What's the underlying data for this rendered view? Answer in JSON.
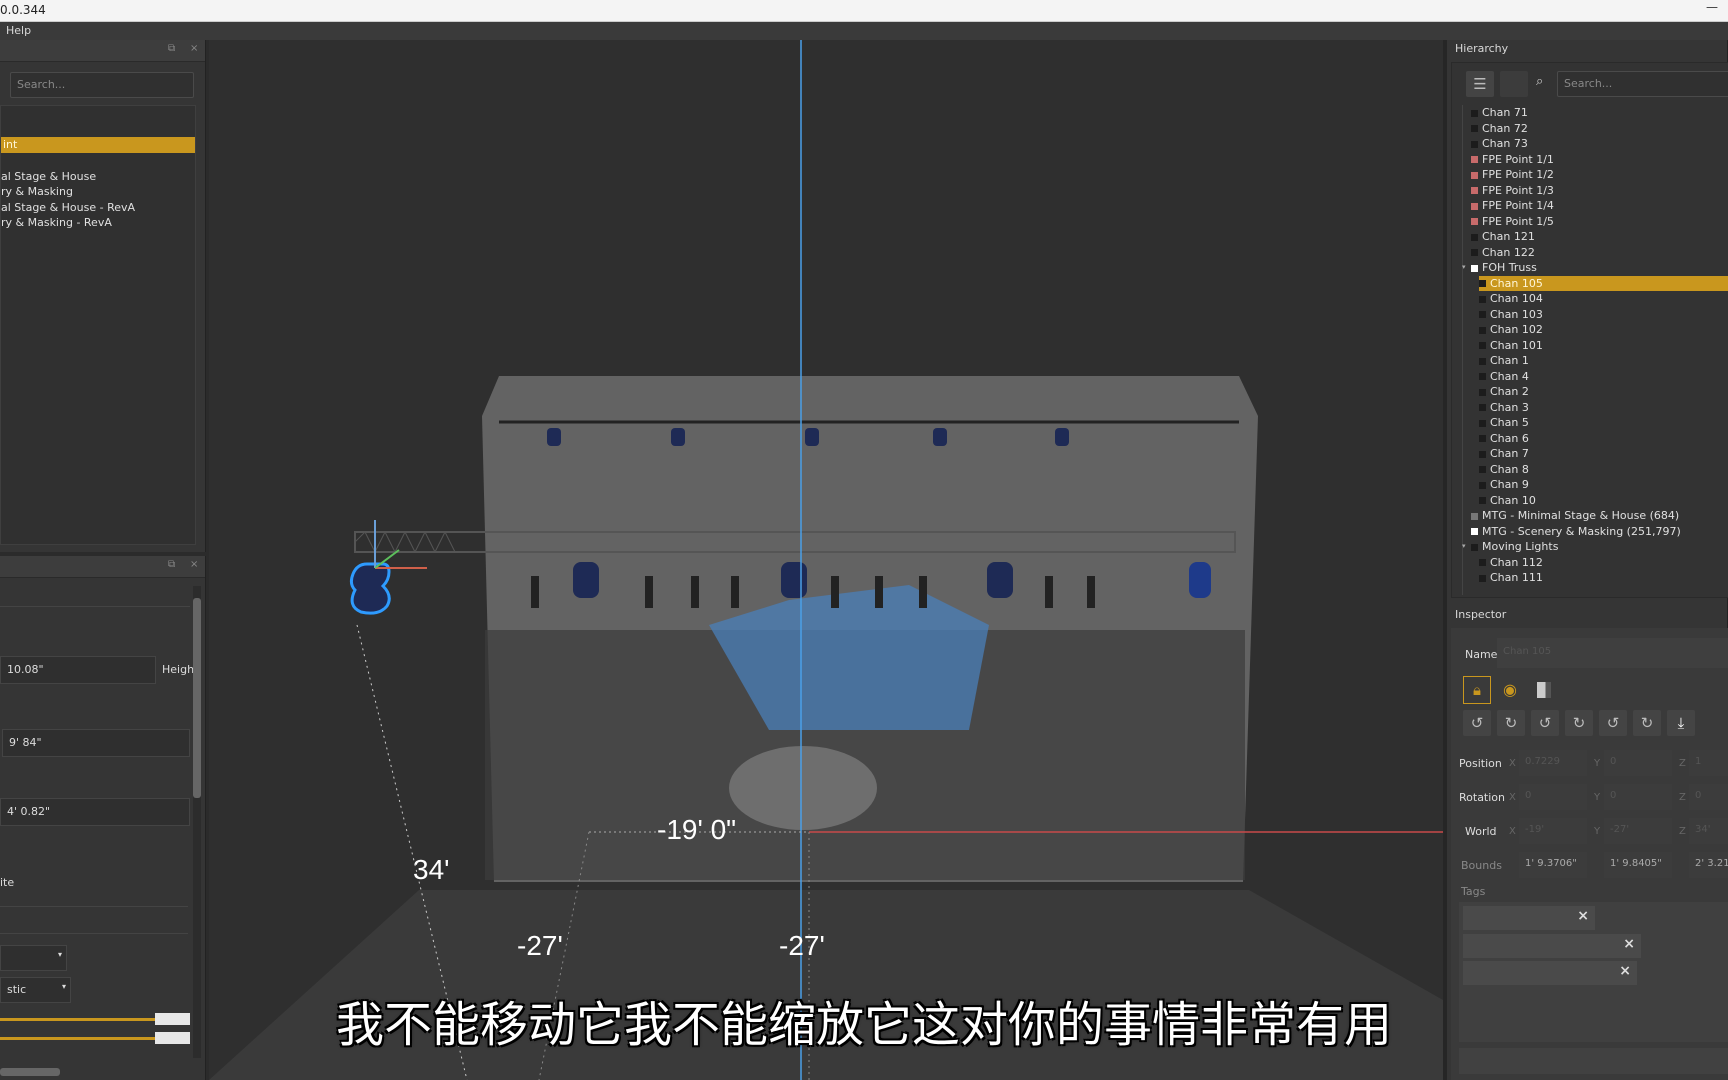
{
  "window": {
    "title": "0.0.344",
    "minimize": "—"
  },
  "menu": {
    "items": [
      "Help"
    ]
  },
  "left_top": {
    "search_placeholder": "Search...",
    "selected": "int",
    "items": [
      "al Stage & House",
      "ry & Masking",
      "al Stage & House - RevA",
      "ry & Masking - RevA"
    ]
  },
  "left_bottom": {
    "fields": {
      "width_value": "10.08\"",
      "height_label": "Heigh",
      "value2": "9' 84\"",
      "value3": "4' 0.82\"",
      "label_te": "ite",
      "dropdown1": "",
      "dropdown2": "stic"
    }
  },
  "viewport": {
    "dimension_x": "-19' 0\"",
    "dimension_depth": "34'",
    "dimension_a": "-27'",
    "dimension_b": "-27'",
    "colors": {
      "axis_blue": "#4a9fe8",
      "axis_red": "#c84a4a",
      "selection": "#2e9bff"
    }
  },
  "hierarchy": {
    "title": "Hierarchy",
    "search_placeholder": "Search...",
    "items": [
      {
        "label": "Chan 71",
        "indent": 0,
        "color": "#1c1c1c"
      },
      {
        "label": "Chan 72",
        "indent": 0,
        "color": "#1c1c1c"
      },
      {
        "label": "Chan 73",
        "indent": 0,
        "color": "#1c1c1c"
      },
      {
        "label": "FPE Point 1/1",
        "indent": 0,
        "color": "#c86b6b"
      },
      {
        "label": "FPE Point 1/2",
        "indent": 0,
        "color": "#c86b6b"
      },
      {
        "label": "FPE Point 1/3",
        "indent": 0,
        "color": "#c86b6b"
      },
      {
        "label": "FPE Point 1/4",
        "indent": 0,
        "color": "#c86b6b"
      },
      {
        "label": "FPE Point 1/5",
        "indent": 0,
        "color": "#c86b6b"
      },
      {
        "label": "Chan 121",
        "indent": 0,
        "color": "#1c1c1c"
      },
      {
        "label": "Chan 122",
        "indent": 0,
        "color": "#1c1c1c"
      },
      {
        "label": "FOH Truss",
        "indent": 0,
        "color": "#ffffff",
        "expanded": true
      },
      {
        "label": "Chan 105",
        "indent": 1,
        "color": "#1c1c1c",
        "selected": true
      },
      {
        "label": "Chan 104",
        "indent": 1,
        "color": "#1c1c1c"
      },
      {
        "label": "Chan 103",
        "indent": 1,
        "color": "#1c1c1c"
      },
      {
        "label": "Chan 102",
        "indent": 1,
        "color": "#1c1c1c"
      },
      {
        "label": "Chan 101",
        "indent": 1,
        "color": "#1c1c1c"
      },
      {
        "label": "Chan 1",
        "indent": 1,
        "color": "#1c1c1c"
      },
      {
        "label": "Chan 4",
        "indent": 1,
        "color": "#1c1c1c"
      },
      {
        "label": "Chan 2",
        "indent": 1,
        "color": "#1c1c1c"
      },
      {
        "label": "Chan 3",
        "indent": 1,
        "color": "#1c1c1c"
      },
      {
        "label": "Chan 5",
        "indent": 1,
        "color": "#1c1c1c"
      },
      {
        "label": "Chan 6",
        "indent": 1,
        "color": "#1c1c1c"
      },
      {
        "label": "Chan 7",
        "indent": 1,
        "color": "#1c1c1c"
      },
      {
        "label": "Chan 8",
        "indent": 1,
        "color": "#1c1c1c"
      },
      {
        "label": "Chan 9",
        "indent": 1,
        "color": "#1c1c1c"
      },
      {
        "label": "Chan 10",
        "indent": 1,
        "color": "#1c1c1c"
      },
      {
        "label": "MTG - Minimal Stage & House (684)",
        "indent": 0,
        "color": "#777777"
      },
      {
        "label": "MTG - Scenery & Masking (251,797)",
        "indent": 0,
        "color": "#ffffff"
      },
      {
        "label": "Moving Lights",
        "indent": 0,
        "color": "#1c1c1c",
        "expanded": true
      },
      {
        "label": "Chan 112",
        "indent": 1,
        "color": "#1c1c1c"
      },
      {
        "label": "Chan 111",
        "indent": 1,
        "color": "#1c1c1c"
      }
    ]
  },
  "inspector": {
    "title": "Inspector",
    "name_label": "Name",
    "name_value": "Chan 105",
    "position_label": "Position",
    "rotation_label": "Rotation",
    "world_label": "World",
    "bounds_label": "Bounds",
    "x": "X",
    "y": "Y",
    "z": "Z",
    "position": [
      "0.7229",
      "0",
      "1"
    ],
    "rotation": [
      "0",
      "0",
      "0"
    ],
    "world": [
      "-19'",
      "-27'",
      "34'"
    ],
    "bounds": [
      "1' 9.3706\"",
      "1' 9.8405\"",
      "2' 3.21"
    ],
    "tags_label": "Tags",
    "accent": "#c9971e"
  },
  "subtitle": "我不能移动它我不能缩放它这对你的事情非常有用"
}
